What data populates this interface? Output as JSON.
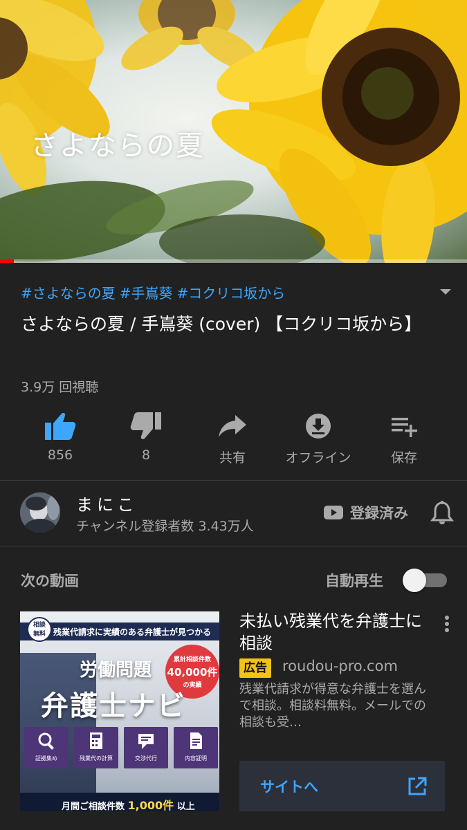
{
  "player": {
    "overlay_title": "さよならの夏",
    "progress_fraction": 0.03
  },
  "video": {
    "hashtags": [
      "#さよならの夏",
      "#手嶌葵",
      "#コクリコ坂から"
    ],
    "title": "さよならの夏 / 手嶌葵 (cover) 【コクリコ坂から】",
    "views": "3.9万 回視聴"
  },
  "actions": {
    "like": "856",
    "dislike": "8",
    "share": "共有",
    "offline": "オフライン",
    "save": "保存"
  },
  "channel": {
    "name": "まにこ",
    "subscribers": "チャンネル登録者数 3.43万人",
    "subscribed_label": "登録済み"
  },
  "up_next": {
    "label": "次の動画",
    "autoplay_label": "自動再生",
    "autoplay_on": false
  },
  "ad": {
    "title": "未払い残業代を弁護士に相談",
    "badge": "広告",
    "domain": "roudou-pro.com",
    "description": "残業代請求が得意な弁護士を選んで相談。相談料無料。メールでの相談も受…",
    "button_label": "サイトへ",
    "thumbnail": {
      "consult_badge_l1": "相談",
      "consult_badge_l2": "無料",
      "banner": "残業代請求に実績のある弁護士が見つかる",
      "count_l1": "累計相談件数",
      "count_l2": "40,000件",
      "count_l3": "の実績",
      "headline1": "労働問題",
      "headline2": "弁護士ナビ",
      "tiles": [
        "証拠集め",
        "残業代の計算",
        "交渉代行",
        "内容証明"
      ],
      "footer_prefix": "月間ご相談件数",
      "footer_highlight": "1,000件",
      "footer_suffix": "以上"
    }
  },
  "colors": {
    "background": "#212121",
    "link_blue": "#3ea6ff",
    "progress_red": "#ff0000",
    "ad_badge": "#f3c316"
  },
  "icons": {
    "like": "thumbs-up-icon",
    "dislike": "thumbs-down-icon",
    "share": "share-arrow-icon",
    "offline": "download-icon",
    "save": "playlist-add-icon",
    "expand": "chevron-down-icon",
    "bell": "bell-icon",
    "subscribed": "youtube-icon",
    "menu": "more-vertical-icon",
    "external": "external-link-icon"
  }
}
